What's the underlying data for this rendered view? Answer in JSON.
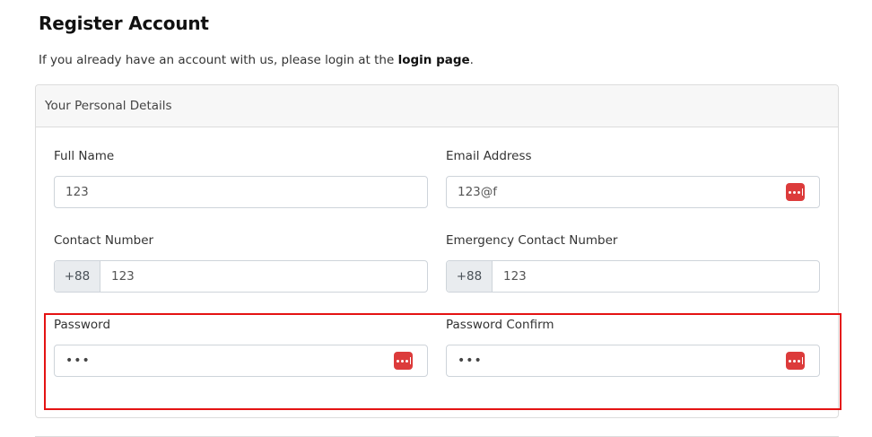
{
  "page": {
    "title": "Register Account",
    "intro_prefix": "If you already have an account with us, please login at the ",
    "intro_link": "login page",
    "intro_suffix": "."
  },
  "card": {
    "header": "Your Personal Details"
  },
  "fields": {
    "full_name": {
      "label": "Full Name",
      "value": "123"
    },
    "email": {
      "label": "Email Address",
      "value": "123@f"
    },
    "contact": {
      "label": "Contact Number",
      "prefix": "+88",
      "value": "123"
    },
    "emergency": {
      "label": "Emergency Contact Number",
      "prefix": "+88",
      "value": "123"
    },
    "password": {
      "label": "Password",
      "value": "•••"
    },
    "password_confirm": {
      "label": "Password Confirm",
      "value": "•••"
    }
  },
  "icons": {
    "password_manager": "password-manager-icon",
    "accent_color": "#dc3b3b"
  },
  "highlight_color": "#e41313"
}
